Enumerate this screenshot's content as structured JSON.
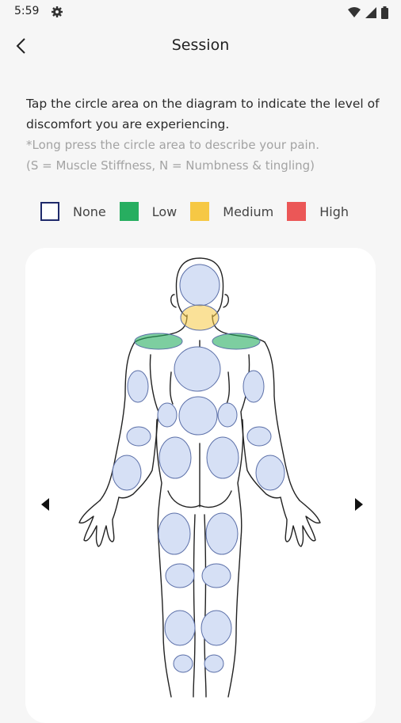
{
  "status": {
    "time": "5:59"
  },
  "header": {
    "title": "Session"
  },
  "instructions": {
    "main": "Tap the circle area on the diagram to indicate the level of discomfort you are experiencing.",
    "note": "*Long press the circle area to describe your pain.",
    "key": "(S = Muscle Stiffness, N = Numbness & tingling)"
  },
  "legend": {
    "none": "None",
    "low": "Low",
    "medium": "Medium",
    "high": "High"
  },
  "colors": {
    "none": "#ffffff",
    "none_border": "#1f2a6b",
    "low": "#27ae60",
    "medium": "#f6c844",
    "high": "#eb5757",
    "zone_default": "#d6e0f5",
    "zone_stroke": "#5b6fa8"
  },
  "icons": {
    "back": "chevron-left-icon",
    "prev_view": "triangle-left-icon",
    "next_view": "triangle-right-icon",
    "settings": "gear-icon",
    "wifi": "wifi-icon",
    "signal": "signal-icon",
    "battery": "battery-icon"
  },
  "body_zones": [
    {
      "name": "head",
      "level": "none"
    },
    {
      "name": "neck",
      "level": "medium"
    },
    {
      "name": "left-shoulder",
      "level": "low"
    },
    {
      "name": "right-shoulder",
      "level": "low"
    },
    {
      "name": "upper-back",
      "level": "none"
    },
    {
      "name": "left-upper-arm",
      "level": "none"
    },
    {
      "name": "right-upper-arm",
      "level": "none"
    },
    {
      "name": "left-flank",
      "level": "none"
    },
    {
      "name": "right-flank",
      "level": "none"
    },
    {
      "name": "mid-back",
      "level": "none"
    },
    {
      "name": "left-elbow",
      "level": "none"
    },
    {
      "name": "right-elbow",
      "level": "none"
    },
    {
      "name": "left-forearm",
      "level": "none"
    },
    {
      "name": "right-forearm",
      "level": "none"
    },
    {
      "name": "left-lower-back",
      "level": "none"
    },
    {
      "name": "right-lower-back",
      "level": "none"
    },
    {
      "name": "left-thigh",
      "level": "none"
    },
    {
      "name": "right-thigh",
      "level": "none"
    },
    {
      "name": "left-knee",
      "level": "none"
    },
    {
      "name": "right-knee",
      "level": "none"
    },
    {
      "name": "left-calf",
      "level": "none"
    },
    {
      "name": "right-calf",
      "level": "none"
    },
    {
      "name": "left-ankle",
      "level": "none"
    },
    {
      "name": "right-ankle",
      "level": "none"
    }
  ]
}
